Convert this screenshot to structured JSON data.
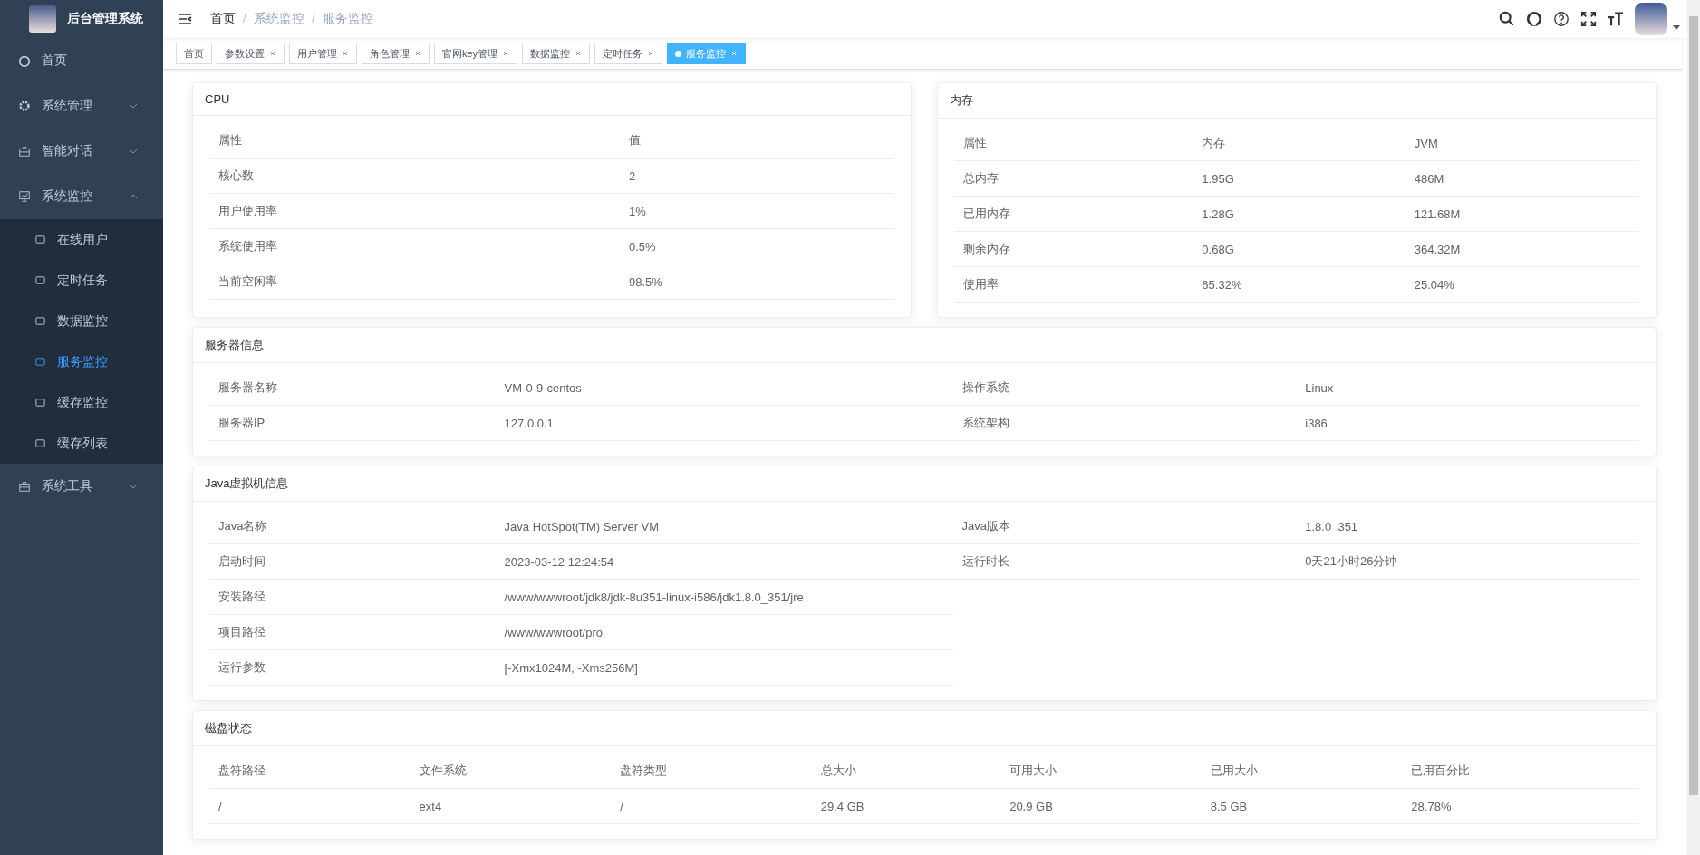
{
  "sidebar": {
    "title": "后台管理系统",
    "items": [
      {
        "label": "首页",
        "selected": false
      },
      {
        "label": "系统管理",
        "expanded": false,
        "selected": false
      },
      {
        "label": "智能对话",
        "expanded": false,
        "selected": false
      },
      {
        "label": "系统监控",
        "expanded": true,
        "selected": false,
        "children": [
          {
            "label": "在线用户",
            "selected": false
          },
          {
            "label": "定时任务",
            "selected": false
          },
          {
            "label": "数据监控",
            "selected": false
          },
          {
            "label": "服务监控",
            "selected": true
          },
          {
            "label": "缓存监控",
            "selected": false
          },
          {
            "label": "缓存列表",
            "selected": false
          }
        ]
      },
      {
        "label": "系统工具",
        "expanded": false,
        "selected": false
      }
    ]
  },
  "breadcrumb": {
    "separator": "/",
    "items": [
      "首页",
      "系统监控",
      "服务监控"
    ]
  },
  "tags": [
    {
      "label": "首页",
      "selected": false,
      "closable": false
    },
    {
      "label": "参数设置",
      "selected": false,
      "closable": true
    },
    {
      "label": "用户管理",
      "selected": false,
      "closable": true
    },
    {
      "label": "角色管理",
      "selected": false,
      "closable": true
    },
    {
      "label": "官网key管理",
      "selected": false,
      "closable": true
    },
    {
      "label": "数据监控",
      "selected": false,
      "closable": true
    },
    {
      "label": "定时任务",
      "selected": false,
      "closable": true
    },
    {
      "label": "服务监控",
      "selected": true,
      "closable": true
    }
  ],
  "panels_top": [
    {
      "title": "CPU",
      "columns": [
        "属性",
        "值"
      ],
      "rows": [
        [
          "核心数",
          "2"
        ],
        [
          "用户使用率",
          "1%"
        ],
        [
          "系统使用率",
          "0.5%"
        ],
        [
          "当前空闲率",
          "98.5%"
        ]
      ]
    },
    {
      "title": "内存",
      "columns": [
        "属性",
        "内存",
        "JVM"
      ],
      "rows": [
        [
          "总内存",
          "1.95G",
          "486M"
        ],
        [
          "已用内存",
          "1.28G",
          "121.68M"
        ],
        [
          "剩余内存",
          "0.68G",
          "364.32M"
        ],
        [
          "使用率",
          "65.32%",
          "25.04%"
        ]
      ]
    }
  ],
  "panels": [
    {
      "title": "服务器信息",
      "rows": [
        [
          "服务器名称",
          "VM-0-9-centos",
          "操作系统",
          "Linux"
        ],
        [
          "服务器IP",
          "127.0.0.1",
          "系统架构",
          "i386"
        ]
      ]
    },
    {
      "title": "Java虚拟机信息",
      "rows": [
        [
          "Java名称",
          "Java HotSpot(TM) Server VM",
          "Java版本",
          "1.8.0_351"
        ],
        [
          "启动时间",
          "2023-03-12 12:24:54",
          "运行时长",
          "0天21小时26分钟"
        ],
        [
          "安装路径",
          "/www/wwwroot/jdk8/jdk-8u351-linux-i586/jdk1.8.0_351/jre"
        ],
        [
          "项目路径",
          "/www/wwwroot/pro"
        ],
        [
          "运行参数",
          "[-Xmx1024M, -Xms256M]"
        ]
      ]
    },
    {
      "title": "磁盘状态",
      "columns": [
        "盘符路径",
        "文件系统",
        "盘符类型",
        "总大小",
        "可用大小",
        "已用大小",
        "已用百分比"
      ],
      "rows": [
        [
          "/",
          "ext4",
          "/",
          "29.4 GB",
          "20.9 GB",
          "8.5 GB",
          "28.78%"
        ]
      ]
    }
  ]
}
